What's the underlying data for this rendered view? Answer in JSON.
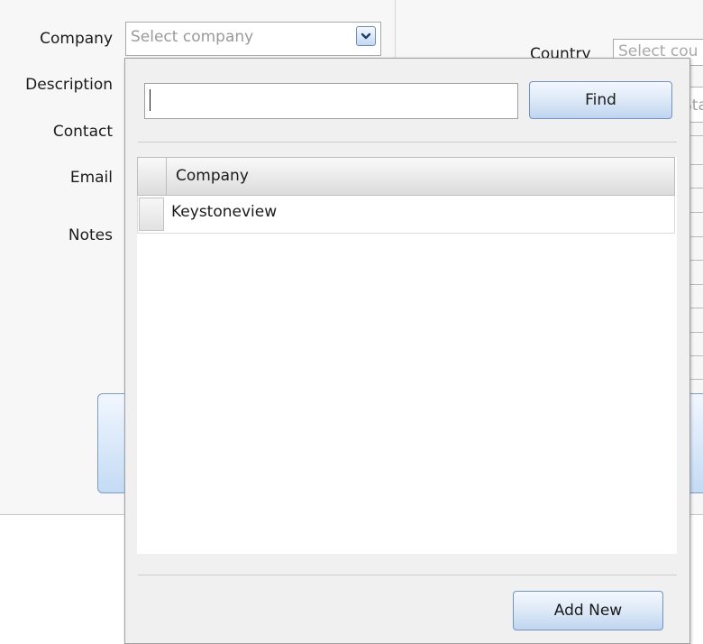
{
  "form": {
    "labels": {
      "company": "Company",
      "description": "Description",
      "contact": "Contact",
      "email": "Email",
      "notes": "Notes"
    },
    "company_select": {
      "placeholder": "Select company",
      "dropdown_icon": "chevron-down-icon"
    },
    "right_column": {
      "country_label_partial": "Country",
      "country_placeholder_partial": "Select cou",
      "state_placeholder_partial": "Sta"
    }
  },
  "dropdown": {
    "search": {
      "value": "",
      "placeholder": ""
    },
    "find_label": "Find",
    "grid": {
      "columns": [
        "Company"
      ],
      "rows": [
        {
          "company": "Keystoneview"
        }
      ]
    },
    "add_new_label": "Add New"
  },
  "colors": {
    "button_gradient_top": "#f3f8ff",
    "button_gradient_bottom": "#c0d5ef",
    "button_border": "#7293c2",
    "placeholder_text": "#9a9a9a",
    "panel_background": "#f7f7f7"
  }
}
